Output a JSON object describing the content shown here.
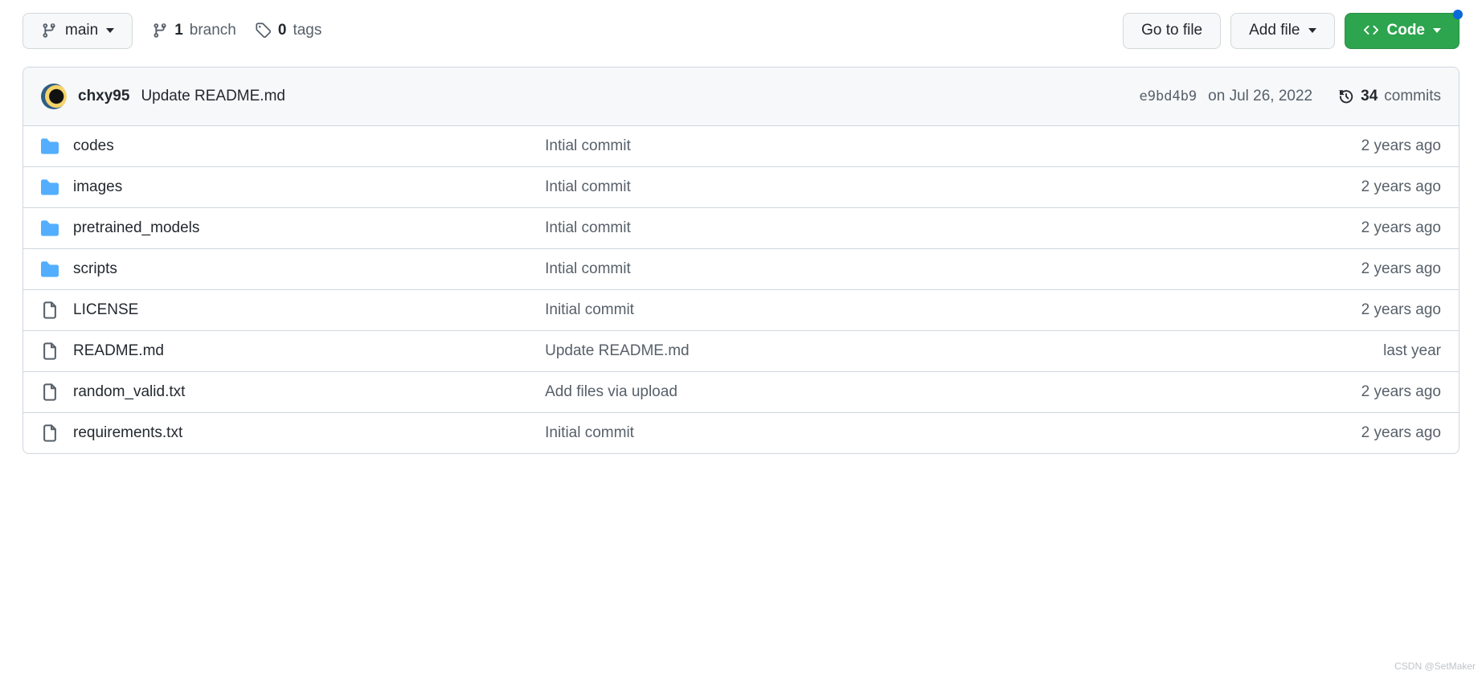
{
  "toolbar": {
    "branch_label": "main",
    "branches_count": "1",
    "branches_word": "branch",
    "tags_count": "0",
    "tags_word": "tags",
    "go_to_file": "Go to file",
    "add_file": "Add file",
    "code": "Code"
  },
  "latest": {
    "author": "chxy95",
    "message": "Update README.md",
    "hash": "e9bd4b9",
    "date": "on Jul 26, 2022",
    "commits_count": "34",
    "commits_word": "commits"
  },
  "files": [
    {
      "type": "dir",
      "name": "codes",
      "msg": "Intial commit",
      "age": "2 years ago"
    },
    {
      "type": "dir",
      "name": "images",
      "msg": "Intial commit",
      "age": "2 years ago"
    },
    {
      "type": "dir",
      "name": "pretrained_models",
      "msg": "Intial commit",
      "age": "2 years ago"
    },
    {
      "type": "dir",
      "name": "scripts",
      "msg": "Intial commit",
      "age": "2 years ago"
    },
    {
      "type": "file",
      "name": "LICENSE",
      "msg": "Initial commit",
      "age": "2 years ago"
    },
    {
      "type": "file",
      "name": "README.md",
      "msg": "Update README.md",
      "age": "last year"
    },
    {
      "type": "file",
      "name": "random_valid.txt",
      "msg": "Add files via upload",
      "age": "2 years ago"
    },
    {
      "type": "file",
      "name": "requirements.txt",
      "msg": "Initial commit",
      "age": "2 years ago"
    }
  ],
  "watermark": "CSDN @SetMaker"
}
